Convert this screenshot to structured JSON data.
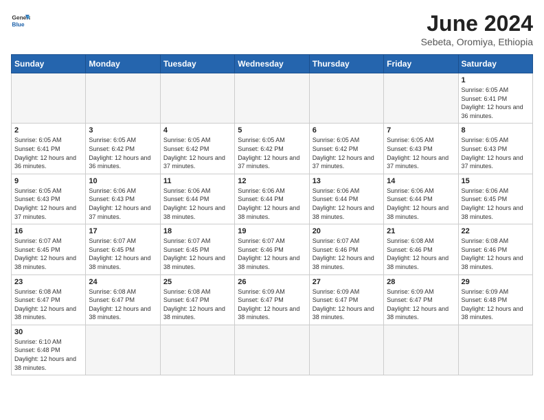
{
  "header": {
    "logo_general": "General",
    "logo_blue": "Blue",
    "title": "June 2024",
    "subtitle": "Sebeta, Oromiya, Ethiopia"
  },
  "days_of_week": [
    "Sunday",
    "Monday",
    "Tuesday",
    "Wednesday",
    "Thursday",
    "Friday",
    "Saturday"
  ],
  "weeks": [
    [
      {
        "day": "",
        "info": ""
      },
      {
        "day": "",
        "info": ""
      },
      {
        "day": "",
        "info": ""
      },
      {
        "day": "",
        "info": ""
      },
      {
        "day": "",
        "info": ""
      },
      {
        "day": "",
        "info": ""
      },
      {
        "day": "1",
        "info": "Sunrise: 6:05 AM\nSunset: 6:41 PM\nDaylight: 12 hours and 36 minutes."
      }
    ],
    [
      {
        "day": "2",
        "info": "Sunrise: 6:05 AM\nSunset: 6:41 PM\nDaylight: 12 hours and 36 minutes."
      },
      {
        "day": "3",
        "info": "Sunrise: 6:05 AM\nSunset: 6:42 PM\nDaylight: 12 hours and 36 minutes."
      },
      {
        "day": "4",
        "info": "Sunrise: 6:05 AM\nSunset: 6:42 PM\nDaylight: 12 hours and 37 minutes."
      },
      {
        "day": "5",
        "info": "Sunrise: 6:05 AM\nSunset: 6:42 PM\nDaylight: 12 hours and 37 minutes."
      },
      {
        "day": "6",
        "info": "Sunrise: 6:05 AM\nSunset: 6:42 PM\nDaylight: 12 hours and 37 minutes."
      },
      {
        "day": "7",
        "info": "Sunrise: 6:05 AM\nSunset: 6:43 PM\nDaylight: 12 hours and 37 minutes."
      },
      {
        "day": "8",
        "info": "Sunrise: 6:05 AM\nSunset: 6:43 PM\nDaylight: 12 hours and 37 minutes."
      }
    ],
    [
      {
        "day": "9",
        "info": "Sunrise: 6:05 AM\nSunset: 6:43 PM\nDaylight: 12 hours and 37 minutes."
      },
      {
        "day": "10",
        "info": "Sunrise: 6:06 AM\nSunset: 6:43 PM\nDaylight: 12 hours and 37 minutes."
      },
      {
        "day": "11",
        "info": "Sunrise: 6:06 AM\nSunset: 6:44 PM\nDaylight: 12 hours and 38 minutes."
      },
      {
        "day": "12",
        "info": "Sunrise: 6:06 AM\nSunset: 6:44 PM\nDaylight: 12 hours and 38 minutes."
      },
      {
        "day": "13",
        "info": "Sunrise: 6:06 AM\nSunset: 6:44 PM\nDaylight: 12 hours and 38 minutes."
      },
      {
        "day": "14",
        "info": "Sunrise: 6:06 AM\nSunset: 6:44 PM\nDaylight: 12 hours and 38 minutes."
      },
      {
        "day": "15",
        "info": "Sunrise: 6:06 AM\nSunset: 6:45 PM\nDaylight: 12 hours and 38 minutes."
      }
    ],
    [
      {
        "day": "16",
        "info": "Sunrise: 6:07 AM\nSunset: 6:45 PM\nDaylight: 12 hours and 38 minutes."
      },
      {
        "day": "17",
        "info": "Sunrise: 6:07 AM\nSunset: 6:45 PM\nDaylight: 12 hours and 38 minutes."
      },
      {
        "day": "18",
        "info": "Sunrise: 6:07 AM\nSunset: 6:45 PM\nDaylight: 12 hours and 38 minutes."
      },
      {
        "day": "19",
        "info": "Sunrise: 6:07 AM\nSunset: 6:46 PM\nDaylight: 12 hours and 38 minutes."
      },
      {
        "day": "20",
        "info": "Sunrise: 6:07 AM\nSunset: 6:46 PM\nDaylight: 12 hours and 38 minutes."
      },
      {
        "day": "21",
        "info": "Sunrise: 6:08 AM\nSunset: 6:46 PM\nDaylight: 12 hours and 38 minutes."
      },
      {
        "day": "22",
        "info": "Sunrise: 6:08 AM\nSunset: 6:46 PM\nDaylight: 12 hours and 38 minutes."
      }
    ],
    [
      {
        "day": "23",
        "info": "Sunrise: 6:08 AM\nSunset: 6:47 PM\nDaylight: 12 hours and 38 minutes."
      },
      {
        "day": "24",
        "info": "Sunrise: 6:08 AM\nSunset: 6:47 PM\nDaylight: 12 hours and 38 minutes."
      },
      {
        "day": "25",
        "info": "Sunrise: 6:08 AM\nSunset: 6:47 PM\nDaylight: 12 hours and 38 minutes."
      },
      {
        "day": "26",
        "info": "Sunrise: 6:09 AM\nSunset: 6:47 PM\nDaylight: 12 hours and 38 minutes."
      },
      {
        "day": "27",
        "info": "Sunrise: 6:09 AM\nSunset: 6:47 PM\nDaylight: 12 hours and 38 minutes."
      },
      {
        "day": "28",
        "info": "Sunrise: 6:09 AM\nSunset: 6:47 PM\nDaylight: 12 hours and 38 minutes."
      },
      {
        "day": "29",
        "info": "Sunrise: 6:09 AM\nSunset: 6:48 PM\nDaylight: 12 hours and 38 minutes."
      }
    ],
    [
      {
        "day": "30",
        "info": "Sunrise: 6:10 AM\nSunset: 6:48 PM\nDaylight: 12 hours and 38 minutes."
      },
      {
        "day": "",
        "info": ""
      },
      {
        "day": "",
        "info": ""
      },
      {
        "day": "",
        "info": ""
      },
      {
        "day": "",
        "info": ""
      },
      {
        "day": "",
        "info": ""
      },
      {
        "day": "",
        "info": ""
      }
    ]
  ]
}
